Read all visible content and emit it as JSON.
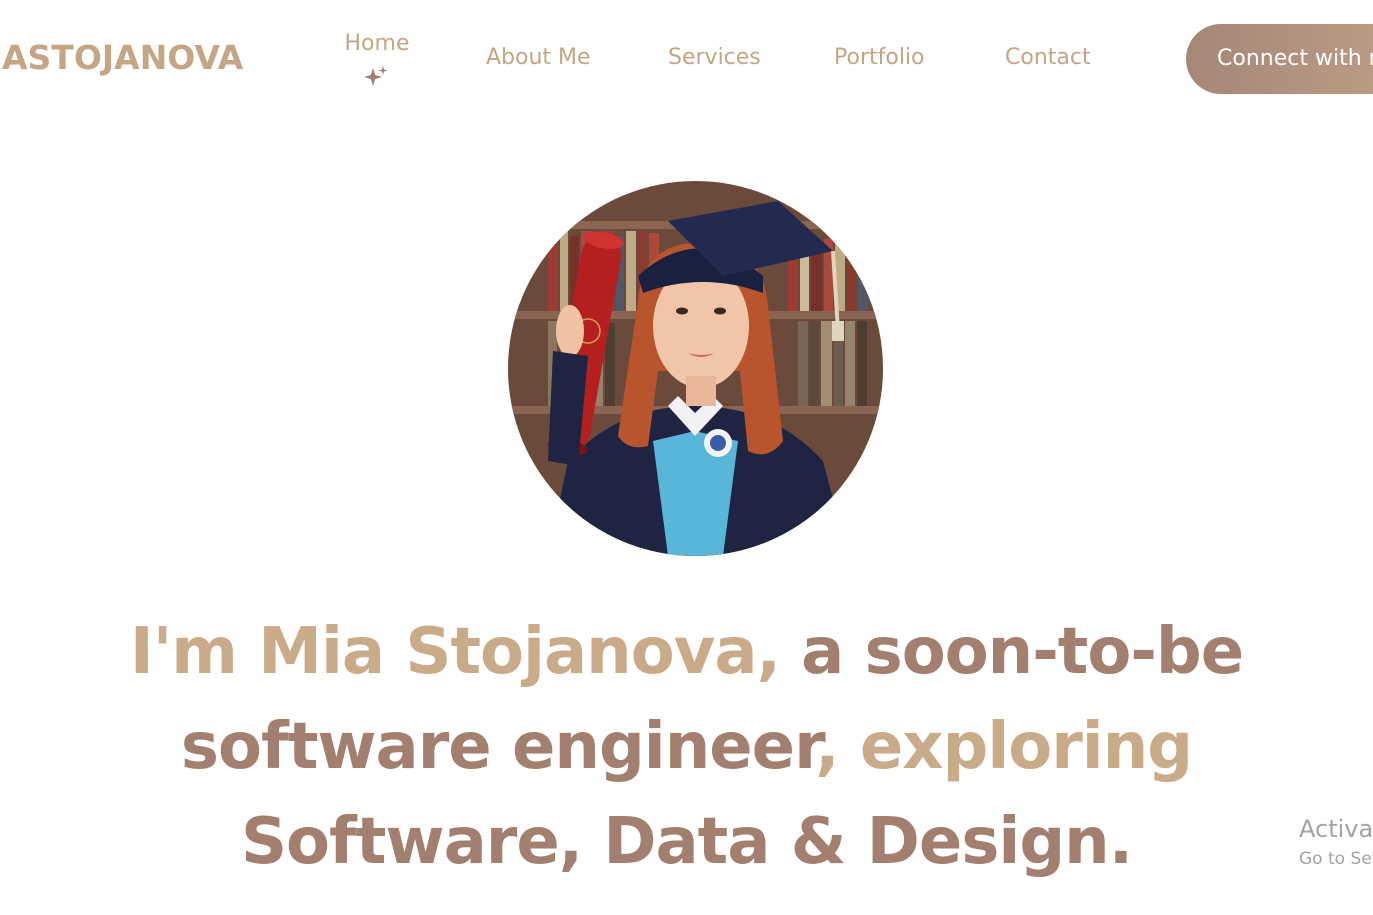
{
  "nav": {
    "logo": "ASTOJANOVA",
    "items": [
      {
        "label": "Home",
        "active": true
      },
      {
        "label": "About Me"
      },
      {
        "label": "Services"
      },
      {
        "label": "Portfolio"
      },
      {
        "label": "Contact"
      }
    ],
    "cta_label": "Connect with me"
  },
  "hero": {
    "headline_parts": [
      {
        "text": "I'm Mia Stojanova, ",
        "style": "accent"
      },
      {
        "text": "a soon-to-be software engineer",
        "style": "main"
      },
      {
        "text": ", exploring ",
        "style": "accent"
      },
      {
        "text": "Software, Data & Design.",
        "style": "main"
      }
    ],
    "avatar_icon": "graduate-portrait"
  },
  "watermark": {
    "line1": "Activate Windows",
    "line2": "Go to Settings to activate Windows."
  },
  "colors": {
    "accent": "#c9ab89",
    "main": "#a27f6f",
    "cta_start": "#a58678",
    "cta_end": "#bfa187"
  }
}
